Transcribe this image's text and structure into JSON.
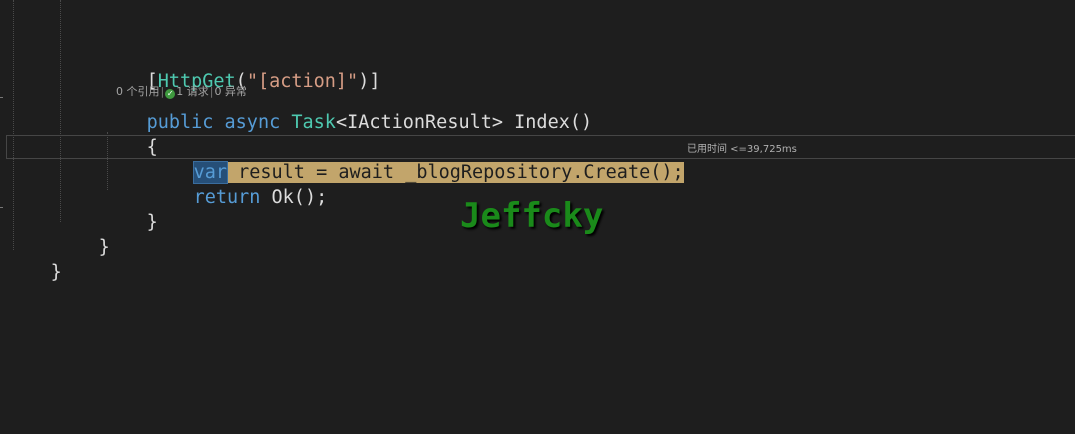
{
  "code": {
    "attribute": {
      "open": "[",
      "name": "HttpGet",
      "paren_open": "(",
      "value": "\"[action]\"",
      "close": ")]"
    },
    "codelens": {
      "references": "0 个引用",
      "requests": "1 请求",
      "exceptions": "0 异常",
      "separator": "|"
    },
    "signature": {
      "public": "public",
      "async": "async",
      "task": "Task",
      "lt": "<",
      "result_type": "IActionResult",
      "gt": ">",
      "method": " Index()"
    },
    "open_brace": "{",
    "statement": {
      "var": "var",
      "rest": " result = await _blogRepository.Create();"
    },
    "elapsed": "已用时间 <=39,725ms",
    "return_kw": "return",
    "return_rest": " Ok();",
    "close_brace_method": "}",
    "close_brace_class": "}",
    "close_brace_ns": "}"
  },
  "watermark": "Jeffcky",
  "colors": {
    "background": "#1e1e1e",
    "keyword": "#569cd6",
    "type": "#4ec9b0",
    "string": "#d69d85",
    "highlight": "#c2a56b",
    "watermark": "#1a8a1a"
  }
}
